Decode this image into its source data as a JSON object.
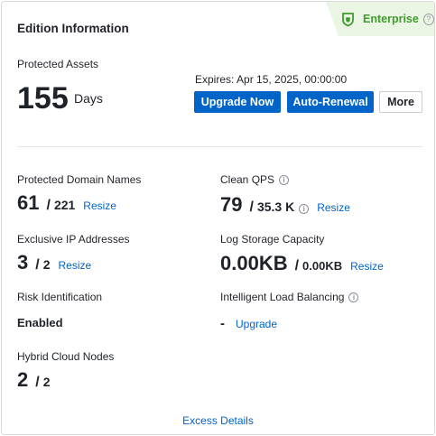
{
  "card": {
    "title": "Edition Information",
    "edition": {
      "label": "Enterprise",
      "help": "?"
    }
  },
  "protected_assets": {
    "label": "Protected Assets",
    "value": "155",
    "unit": "Days"
  },
  "expires": "Expires: Apr 15, 2025, 00:00:00",
  "buttons": {
    "upgrade_now": "Upgrade Now",
    "auto_renewal": "Auto-Renewal",
    "more": "More"
  },
  "metrics": {
    "domains": {
      "label": "Protected Domain Names",
      "used": "61",
      "total": "221",
      "action": "Resize"
    },
    "qps": {
      "label": "Clean QPS",
      "used": "79",
      "total": "35.3 K",
      "action": "Resize"
    },
    "ips": {
      "label": "Exclusive IP Addresses",
      "used": "3",
      "total": "2",
      "action": "Resize"
    },
    "log_storage": {
      "label": "Log Storage Capacity",
      "used": "0.00KB",
      "total": "0.00KB",
      "action": "Resize"
    },
    "risk": {
      "label": "Risk Identification",
      "value": "Enabled"
    },
    "load_balancing": {
      "label": "Intelligent Load Balancing",
      "value": "-",
      "action": "Upgrade"
    },
    "hybrid": {
      "label": "Hybrid Cloud Nodes",
      "used": "2",
      "total": "2"
    }
  },
  "excess_details": "Excess Details",
  "colors": {
    "primary": "#0064c8",
    "enterprise_green": "#3f9c2e",
    "badge_bg": "#eaf6e3"
  },
  "icons": {
    "edition": "shield-icon",
    "help": "help-circle-icon",
    "info": "info-circle-icon"
  }
}
